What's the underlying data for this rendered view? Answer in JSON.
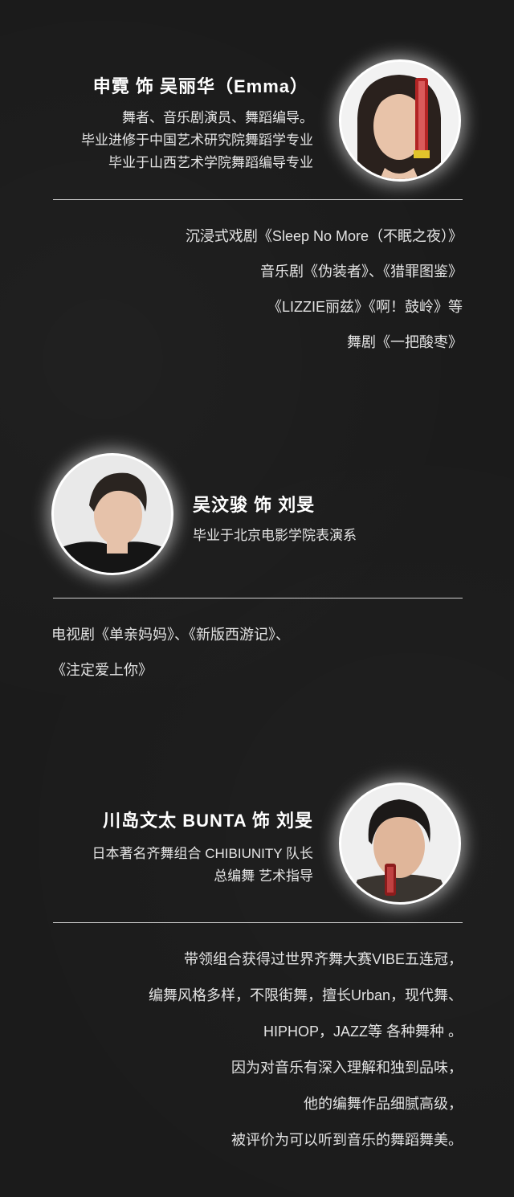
{
  "cast": [
    {
      "name_line": "申霓 饰 吴丽华（Emma）",
      "bio": [
        "舞者、音乐剧演员、舞蹈编导。",
        "毕业进修于中国艺术研究院舞蹈学专业",
        "毕业于山西艺术学院舞蹈编导专业"
      ],
      "works": [
        "沉浸式戏剧《Sleep No More（不眠之夜）》",
        "音乐剧《伪装者》、《猎罪图鉴》",
        "《LIZZIE丽兹》《啊！鼓岭》等",
        "舞剧《一把酸枣》"
      ]
    },
    {
      "name_line": "吴汶骏 饰 刘旻",
      "bio": [
        "毕业于北京电影学院表演系"
      ],
      "works": [
        "电视剧《单亲妈妈》、《新版西游记》、",
        "《注定爱上你》"
      ]
    },
    {
      "name_line": "川岛文太 BUNTA 饰 刘旻",
      "bio": [
        "日本著名齐舞组合 CHIBIUNITY 队长",
        "总编舞 艺术指导"
      ],
      "works": [
        "带领组合获得过世界齐舞大赛VIBE五连冠，",
        "编舞风格多样，不限街舞，擅长Urban，现代舞、",
        "HIPHOP，JAZZ等 各种舞种 。",
        "因为对音乐有深入理解和独到品味，",
        "他的编舞作品细腻高级，",
        "被评价为可以听到音乐的舞蹈舞美。"
      ]
    }
  ]
}
